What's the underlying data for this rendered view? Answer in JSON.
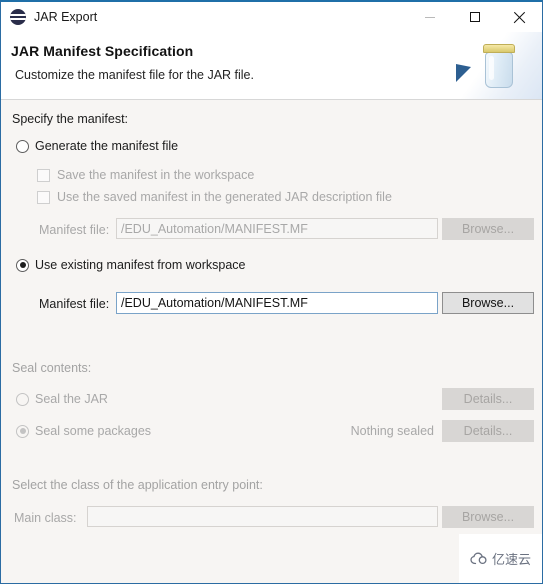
{
  "window": {
    "title": "JAR Export",
    "app_icon": "jar-export-icon",
    "controls": {
      "minimize": "minimize-icon",
      "maximize": "maximize-icon",
      "close": "close-icon"
    }
  },
  "header": {
    "title": "JAR Manifest Specification",
    "subtitle": "Customize the manifest file for the JAR file.",
    "art_icon": "jar-illustration"
  },
  "manifest_section": {
    "label": "Specify the manifest:",
    "generate_option": {
      "label": "Generate the manifest file",
      "selected": false
    },
    "checkboxes": [
      {
        "label": "Save the manifest in the workspace",
        "checked": false,
        "enabled": false
      },
      {
        "label": "Use the saved manifest in the generated JAR description file",
        "checked": false,
        "enabled": false
      }
    ],
    "generate_file_row": {
      "label": "Manifest file:",
      "value": "/EDU_Automation/MANIFEST.MF",
      "browse_label": "Browse...",
      "enabled": false
    },
    "existing_option": {
      "label": "Use existing manifest from workspace",
      "selected": true
    },
    "existing_file_row": {
      "label": "Manifest file:",
      "value": "/EDU_Automation/MANIFEST.MF",
      "browse_label": "Browse...",
      "enabled": true
    }
  },
  "seal_section": {
    "label": "Seal contents:",
    "seal_jar": {
      "label": "Seal the JAR",
      "selected": false,
      "details_label": "Details..."
    },
    "seal_packages": {
      "label": "Seal some packages",
      "selected": true,
      "status": "Nothing sealed",
      "details_label": "Details..."
    }
  },
  "entry_section": {
    "label": "Select the class of the application entry point:",
    "main_class": {
      "label": "Main class:",
      "value": "",
      "browse_label": "Browse...",
      "enabled": false
    }
  },
  "watermark": {
    "icon": "cloud-icon",
    "text": "亿速云"
  }
}
